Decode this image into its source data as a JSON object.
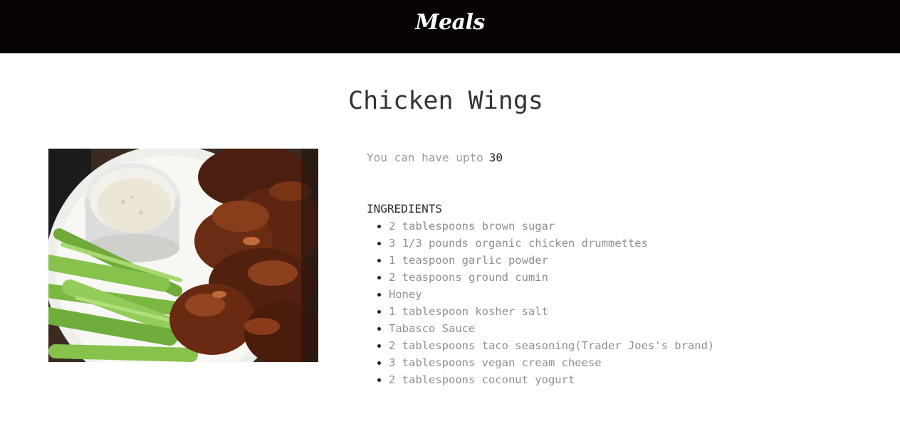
{
  "header": {
    "brand": "Meals",
    "background": "#080404"
  },
  "recipe": {
    "title": "Chicken Wings",
    "image_subject": "chicken wings with celery sticks and ranch dip",
    "allowance_label": "You can have upto",
    "allowance_value": "30",
    "ingredients_heading": "INGREDIENTS",
    "ingredients": [
      "2 tablespoons brown sugar",
      "3 1/3 pounds organic chicken drummettes",
      "1 teaspoon garlic powder",
      "2 teaspoons ground cumin",
      "Honey",
      "1 tablespoon kosher salt",
      "Tabasco Sauce",
      "2 tablespoons taco seasoning(Trader Joes's brand)",
      "3 tablespoons vegan cream cheese",
      "2 tablespoons coconut yogurt"
    ]
  }
}
